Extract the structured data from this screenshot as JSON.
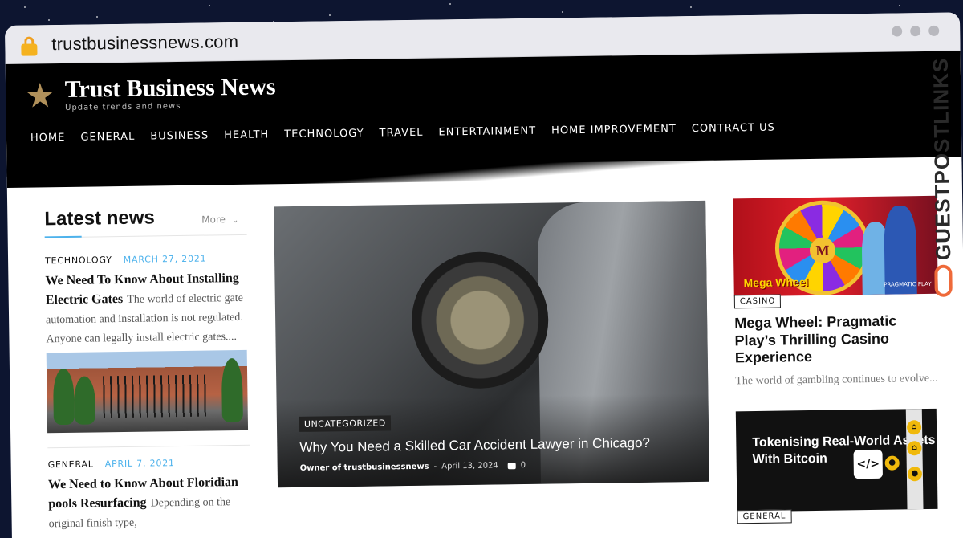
{
  "browser": {
    "url": "trustbusinessnews.com"
  },
  "site": {
    "title": "Trust Business News",
    "tagline": "Update trends and news",
    "nav": [
      "HOME",
      "GENERAL",
      "BUSINESS",
      "HEALTH",
      "TECHNOLOGY",
      "TRAVEL",
      "ENTERTAINMENT",
      "HOME IMPROVEMENT",
      "CONTRACT US"
    ]
  },
  "latest": {
    "heading": "Latest news",
    "more_label": "More",
    "posts": [
      {
        "category": "TECHNOLOGY",
        "date": "MARCH 27, 2021",
        "title": "We Need To Know About Installing Electric Gates",
        "excerpt": "The world of electric gate automation and installation is not regulated. Anyone can legally install electric gates...."
      },
      {
        "category": "GENERAL",
        "date": "APRIL 7, 2021",
        "title": "We Need to Know About Floridian pools Resurfacing",
        "excerpt": "Depending on the original finish type,"
      }
    ]
  },
  "hero": {
    "category": "UNCATEGORIZED",
    "title": "Why You Need a Skilled Car Accident Lawyer in Chicago?",
    "author": "Owner of trustbusinessnews",
    "separator": "-",
    "date": "April 13, 2024",
    "comments": "0"
  },
  "right": {
    "casino": {
      "category": "CASINO",
      "title": "Mega Wheel: Pragmatic Play’s Thrilling Casino Experience",
      "excerpt": "The world of gambling continues to evolve...",
      "image_logo": "Mega Wheel",
      "image_brand": "PRAGMATIC PLAY",
      "image_center": "M"
    },
    "btc": {
      "category": "GENERAL",
      "image_text": "Tokenising Real-World Assets With Bitcoin",
      "image_code": "</>"
    }
  },
  "watermark": {
    "text": "GUESTPOSTLINKS"
  },
  "colors": {
    "accent": "#4db2ec",
    "header_bg": "#000000",
    "logo_star": "#b0905a",
    "watermark_icon": "#ef6a3a"
  }
}
